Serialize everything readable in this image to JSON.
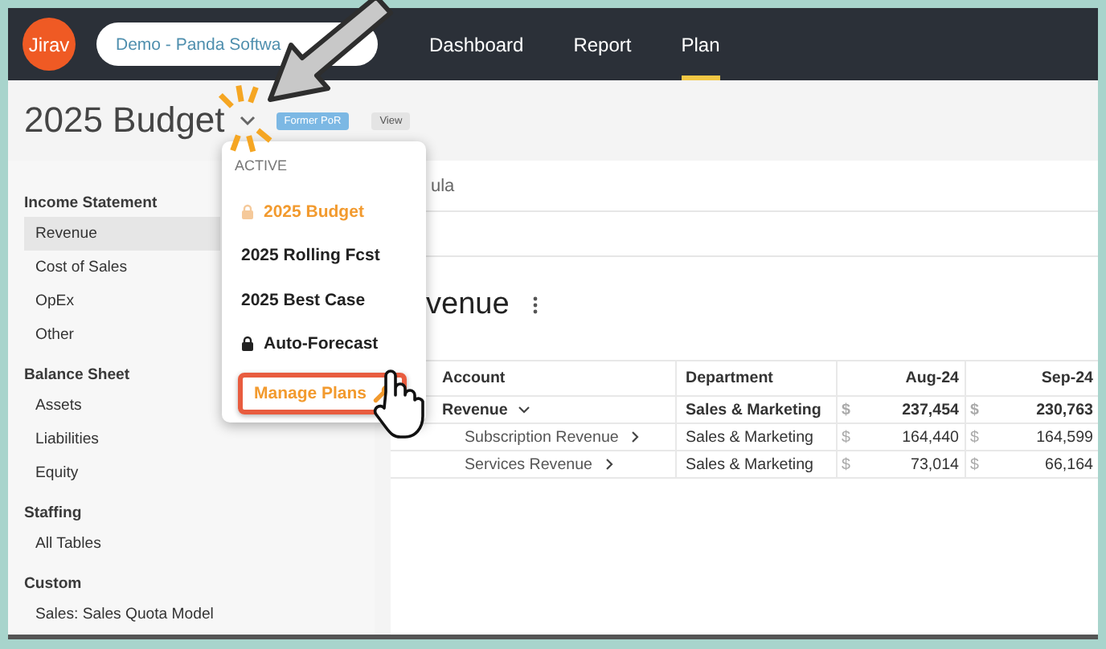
{
  "header": {
    "logo": "Jirav",
    "workspace": "Demo - Panda Softwa",
    "nav": [
      {
        "label": "Dashboard",
        "selected": false
      },
      {
        "label": "Report",
        "selected": false
      },
      {
        "label": "Plan",
        "selected": true
      }
    ]
  },
  "plan_title": {
    "title": "2025 Budget",
    "badges": [
      {
        "label": "Former PoR",
        "kind": "status"
      },
      {
        "label": "View",
        "kind": "mode"
      }
    ]
  },
  "sidebar": {
    "sections": [
      {
        "heading": "Income Statement",
        "items": [
          {
            "label": "Revenue",
            "selected": true
          },
          {
            "label": "Cost of Sales",
            "selected": false
          },
          {
            "label": "OpEx",
            "selected": false
          },
          {
            "label": "Other",
            "selected": false
          }
        ]
      },
      {
        "heading": "Balance Sheet",
        "items": [
          {
            "label": "Assets",
            "selected": false
          },
          {
            "label": "Liabilities",
            "selected": false
          },
          {
            "label": "Equity",
            "selected": false
          }
        ]
      },
      {
        "heading": "Staffing",
        "items": [
          {
            "label": "All Tables",
            "selected": false
          }
        ]
      },
      {
        "heading": "Custom",
        "items": [
          {
            "label": "Sales: Sales Quota Model",
            "selected": false
          }
        ]
      }
    ]
  },
  "main": {
    "tab_partial": "ula",
    "section_title": "venue",
    "table": {
      "columns": [
        "Account",
        "Department",
        "Aug-24",
        "Sep-24"
      ],
      "rows": [
        {
          "account": "Revenue",
          "kind": "total",
          "expanded": true,
          "department": "Sales & Marketing",
          "cells": [
            {
              "currency": "$",
              "value": "237,454"
            },
            {
              "currency": "$",
              "value": "230,763"
            }
          ]
        },
        {
          "account": "Subscription Revenue",
          "kind": "child",
          "expanded": false,
          "department": "Sales & Marketing",
          "cells": [
            {
              "currency": "$",
              "value": "164,440"
            },
            {
              "currency": "$",
              "value": "164,599"
            }
          ]
        },
        {
          "account": "Services Revenue",
          "kind": "child",
          "expanded": false,
          "department": "Sales & Marketing",
          "cells": [
            {
              "currency": "$",
              "value": "73,014"
            },
            {
              "currency": "$",
              "value": "66,164"
            }
          ]
        }
      ]
    }
  },
  "plan_menu": {
    "heading": "ACTIVE",
    "items": [
      {
        "label": "2025 Budget",
        "kind": "plan",
        "locked": true,
        "selected": true
      },
      {
        "label": "2025 Rolling Fcst",
        "kind": "plan",
        "locked": false,
        "selected": false
      },
      {
        "label": "2025 Best Case",
        "kind": "plan",
        "locked": false,
        "selected": false
      },
      {
        "label": "Auto-Forecast",
        "kind": "plan",
        "locked": true,
        "selected": false
      },
      {
        "label": "Manage Plans",
        "kind": "action",
        "highlighted": true
      }
    ]
  }
}
